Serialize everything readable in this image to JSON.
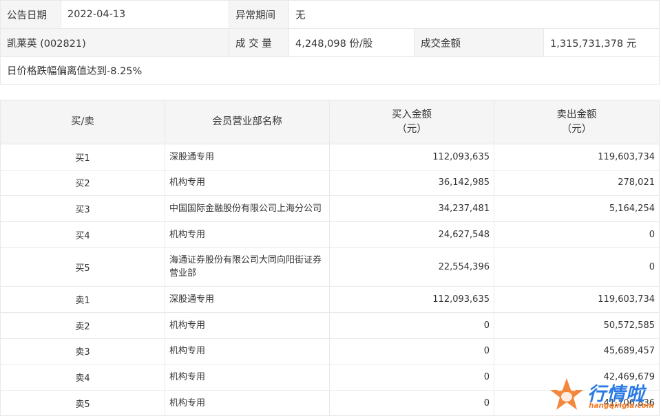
{
  "info": {
    "date_label": "公告日期",
    "date_value": "2022-04-13",
    "period_label": "异常期间",
    "period_value": "无",
    "stock": "凯莱英 (002821)",
    "volume_label": "成 交 量",
    "volume_value": "4,248,098 份/股",
    "amount_label": "成交金额",
    "amount_value": "1,315,731,378 元",
    "reason": "日价格跌幅偏离值达到-8.25%"
  },
  "table": {
    "headers": {
      "side": "买/卖",
      "dept": "会员营业部名称",
      "buy_line1": "买入金额",
      "buy_line2": "（元）",
      "sell_line1": "卖出金额",
      "sell_line2": "（元）"
    },
    "rows": [
      {
        "side": "买1",
        "name": "深股通专用",
        "buy": "112,093,635",
        "sell": "119,603,734"
      },
      {
        "side": "买2",
        "name": "机构专用",
        "buy": "36,142,985",
        "sell": "278,021"
      },
      {
        "side": "买3",
        "name": "中国国际金融股份有限公司上海分公司",
        "buy": "34,237,481",
        "sell": "5,164,254"
      },
      {
        "side": "买4",
        "name": "机构专用",
        "buy": "24,627,548",
        "sell": "0"
      },
      {
        "side": "买5",
        "name": "海通证券股份有限公司大同向阳街证券营业部",
        "buy": "22,554,396",
        "sell": "0"
      },
      {
        "side": "卖1",
        "name": "深股通专用",
        "buy": "112,093,635",
        "sell": "119,603,734"
      },
      {
        "side": "卖2",
        "name": "机构专用",
        "buy": "0",
        "sell": "50,572,585"
      },
      {
        "side": "卖3",
        "name": "机构专用",
        "buy": "0",
        "sell": "45,689,457"
      },
      {
        "side": "卖4",
        "name": "机构专用",
        "buy": "0",
        "sell": "42,469,679"
      },
      {
        "side": "卖5",
        "name": "机构专用",
        "buy": "0",
        "sell": "41,706,836"
      }
    ]
  },
  "watermark": {
    "brand": "行情啦",
    "url": "hangqingla.com",
    "icon": "bull-star-logo-icon",
    "brand_color": "#2a7be4",
    "accent_color": "#f27b28"
  }
}
